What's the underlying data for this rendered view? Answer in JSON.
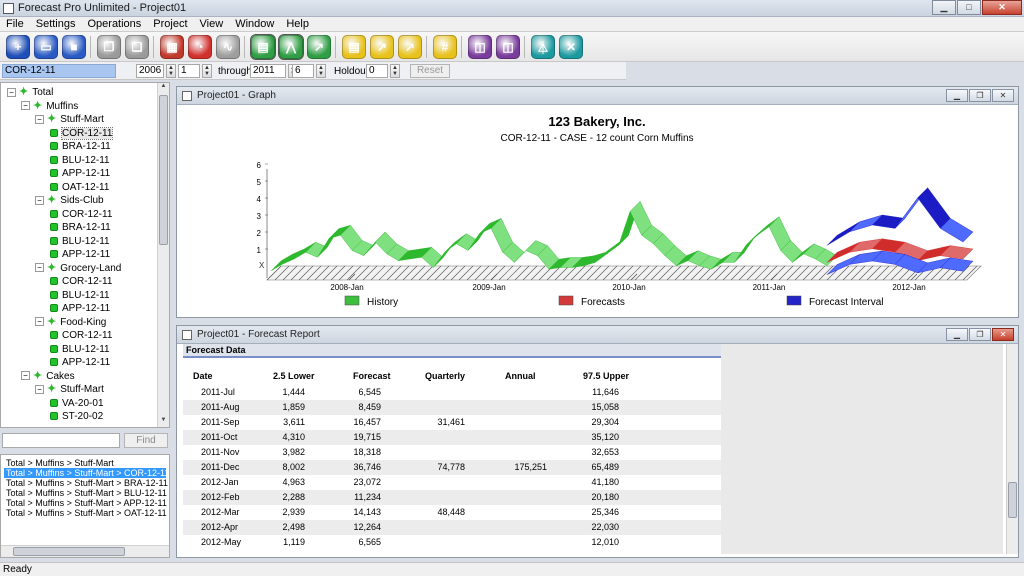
{
  "window": {
    "title": "Forecast Pro Unlimited - Project01"
  },
  "menu": [
    "File",
    "Settings",
    "Operations",
    "Project",
    "View",
    "Window",
    "Help"
  ],
  "toolbar": {
    "buttons": [
      {
        "name": "new-project-button",
        "icon": "new-icon",
        "color": "#1f4fb8"
      },
      {
        "name": "open-project-button",
        "icon": "folder-open-icon",
        "color": "#2a5bc4"
      },
      {
        "name": "save-project-button",
        "icon": "save-icon",
        "color": "#2a5bc4"
      },
      {
        "name": "copy-button",
        "icon": "copy-icon",
        "color": "#9a9a9a"
      },
      {
        "name": "paste-button",
        "icon": "paste-icon",
        "color": "#9a9a9a"
      },
      {
        "name": "movie-button",
        "icon": "clapper-icon",
        "color": "#c0392b"
      },
      {
        "name": "pie-chart-button",
        "icon": "pie-chart-icon",
        "color": "#d0312d"
      },
      {
        "name": "line-chart-button",
        "icon": "line-chart-icon",
        "color": "#9e9e9e"
      },
      {
        "name": "report-view-button",
        "icon": "report-icon",
        "color": "#2f9e44"
      },
      {
        "name": "graph-view-button",
        "icon": "graph-icon",
        "color": "#2f9e44"
      },
      {
        "name": "trend-button",
        "icon": "trend-icon",
        "color": "#2f9e44"
      },
      {
        "name": "notes-button",
        "icon": "notes-icon",
        "color": "#e8c21c"
      },
      {
        "name": "adjust-button",
        "icon": "adjust-icon",
        "color": "#e8c21c"
      },
      {
        "name": "override-button",
        "icon": "override-icon",
        "color": "#e8c21c"
      },
      {
        "name": "hash-button",
        "icon": "hash-icon",
        "color": "#e8c21c"
      },
      {
        "name": "windows-button",
        "icon": "windows-icon",
        "color": "#7a3c9c"
      },
      {
        "name": "settings-window-button",
        "icon": "settings-icon",
        "color": "#7a3c9c"
      },
      {
        "name": "filter-button",
        "icon": "filter-icon",
        "color": "#1c9aa0"
      },
      {
        "name": "tools-button",
        "icon": "tools-icon",
        "color": "#1c9aa0"
      }
    ]
  },
  "params": {
    "item": "COR-12-11",
    "start_year": "2006",
    "start_period": "1",
    "through_label": "through",
    "end_year": "2011",
    "end_period": "6",
    "holdout_label": "Holdout",
    "holdout": "0",
    "reset_label": "Reset"
  },
  "tree": [
    {
      "label": "Total",
      "level": 0,
      "type": "node"
    },
    {
      "label": "Muffins",
      "level": 1,
      "type": "node"
    },
    {
      "label": "Stuff-Mart",
      "level": 2,
      "type": "node"
    },
    {
      "label": "COR-12-11",
      "level": 3,
      "type": "leaf",
      "selected": true
    },
    {
      "label": "BRA-12-11",
      "level": 3,
      "type": "leaf"
    },
    {
      "label": "BLU-12-11",
      "level": 3,
      "type": "leaf"
    },
    {
      "label": "APP-12-11",
      "level": 3,
      "type": "leaf"
    },
    {
      "label": "OAT-12-11",
      "level": 3,
      "type": "leaf"
    },
    {
      "label": "Sids-Club",
      "level": 2,
      "type": "node"
    },
    {
      "label": "COR-12-11",
      "level": 3,
      "type": "leaf"
    },
    {
      "label": "BRA-12-11",
      "level": 3,
      "type": "leaf"
    },
    {
      "label": "BLU-12-11",
      "level": 3,
      "type": "leaf"
    },
    {
      "label": "APP-12-11",
      "level": 3,
      "type": "leaf"
    },
    {
      "label": "Grocery-Land",
      "level": 2,
      "type": "node"
    },
    {
      "label": "COR-12-11",
      "level": 3,
      "type": "leaf"
    },
    {
      "label": "BLU-12-11",
      "level": 3,
      "type": "leaf"
    },
    {
      "label": "APP-12-11",
      "level": 3,
      "type": "leaf"
    },
    {
      "label": "Food-King",
      "level": 2,
      "type": "node"
    },
    {
      "label": "COR-12-11",
      "level": 3,
      "type": "leaf"
    },
    {
      "label": "BLU-12-11",
      "level": 3,
      "type": "leaf"
    },
    {
      "label": "APP-12-11",
      "level": 3,
      "type": "leaf"
    },
    {
      "label": "Cakes",
      "level": 1,
      "type": "node"
    },
    {
      "label": "Stuff-Mart",
      "level": 2,
      "type": "node"
    },
    {
      "label": "VA-20-01",
      "level": 3,
      "type": "leaf"
    },
    {
      "label": "ST-20-02",
      "level": 3,
      "type": "leaf"
    }
  ],
  "find": {
    "value": "",
    "button_label": "Find"
  },
  "paths": [
    {
      "label": "Total > Muffins > Stuff-Mart",
      "selected": false
    },
    {
      "label": "Total > Muffins > Stuff-Mart > COR-12-11",
      "selected": true
    },
    {
      "label": "Total > Muffins > Stuff-Mart > BRA-12-11",
      "selected": false
    },
    {
      "label": "Total > Muffins > Stuff-Mart > BLU-12-11",
      "selected": false
    },
    {
      "label": "Total > Muffins > Stuff-Mart > APP-12-11",
      "selected": false
    },
    {
      "label": "Total > Muffins > Stuff-Mart > OAT-12-11",
      "selected": false
    }
  ],
  "graph_window": {
    "title": "Project01 - Graph",
    "chart_title": "123 Bakery, Inc.",
    "chart_subtitle": "COR-12-11 - CASE - 12 count Corn Muffins",
    "y_ticks": [
      "1",
      "2",
      "3",
      "4",
      "5",
      "6"
    ],
    "x_ticks": [
      "2008-Jan",
      "2009-Jan",
      "2010-Jan",
      "2011-Jan",
      "2012-Jan"
    ],
    "legend": [
      {
        "label": "History",
        "color": "#3cbf3c"
      },
      {
        "label": "Forecasts",
        "color": "#d53a3a"
      },
      {
        "label": "Forecast Interval",
        "color": "#2424c8"
      }
    ],
    "colors": {
      "history": "#2db82d",
      "history_light": "#7fe07f",
      "forecast": "#d02c2c",
      "interval": "#1c1cc4",
      "interval_light": "#4f6bff"
    }
  },
  "chart_data": {
    "type": "area",
    "title": "123 Bakery, Inc.",
    "subtitle": "COR-12-11 - CASE - 12 count Corn Muffins",
    "x_ticks": [
      "2008-Jan",
      "2009-Jan",
      "2010-Jan",
      "2011-Jan",
      "2012-Jan"
    ],
    "y_ticks": [
      1,
      2,
      3,
      4,
      5,
      6
    ],
    "series": [
      {
        "name": "History",
        "values": [
          0.3,
          0.7,
          1.0,
          1.4,
          1.1,
          2.2,
          2.4,
          1.5,
          1.2,
          2.0,
          1.3,
          0.9,
          1.0,
          1.1,
          0.5,
          1.4,
          1.9,
          1.5,
          2.5,
          2.8,
          1.4,
          0.8,
          1.5,
          1.2,
          0.4,
          0.5,
          0.5,
          0.6,
          0.8,
          1.3,
          1.8,
          3.8,
          2.4,
          1.9,
          1.2,
          0.6,
          0.9,
          0.6,
          0.4,
          0.8,
          0.8,
          1.8,
          2.4,
          2.9,
          1.5,
          0.8,
          1.3,
          1.0,
          0.6
        ]
      },
      {
        "name": "Forecasts",
        "values": [
          0.8,
          1.4,
          1.6,
          1.4,
          0.9,
          1.2,
          1.0
        ]
      },
      {
        "name": "Forecast Interval",
        "values": [
          1.8,
          2.6,
          3.0,
          2.8,
          4.6,
          2.8,
          2.0
        ]
      }
    ]
  },
  "report_window": {
    "title": "Project01 - Forecast Report",
    "section_title": "Forecast Data",
    "columns": [
      "Date",
      "2.5 Lower",
      "Forecast",
      "Quarterly",
      "Annual",
      "97.5 Upper"
    ],
    "rows": [
      [
        "2011-Jul",
        "1,444",
        "6,545",
        "",
        "",
        "11,646"
      ],
      [
        "2011-Aug",
        "1,859",
        "8,459",
        "",
        "",
        "15,058"
      ],
      [
        "2011-Sep",
        "3,611",
        "16,457",
        "31,461",
        "",
        "29,304"
      ],
      [
        "2011-Oct",
        "4,310",
        "19,715",
        "",
        "",
        "35,120"
      ],
      [
        "2011-Nov",
        "3,982",
        "18,318",
        "",
        "",
        "32,653"
      ],
      [
        "2011-Dec",
        "8,002",
        "36,746",
        "74,778",
        "175,251",
        "65,489"
      ],
      [
        "2012-Jan",
        "4,963",
        "23,072",
        "",
        "",
        "41,180"
      ],
      [
        "2012-Feb",
        "2,288",
        "11,234",
        "",
        "",
        "20,180"
      ],
      [
        "2012-Mar",
        "2,939",
        "14,143",
        "48,448",
        "",
        "25,346"
      ],
      [
        "2012-Apr",
        "2,498",
        "12,264",
        "",
        "",
        "22,030"
      ],
      [
        "2012-May",
        "1,119",
        "6,565",
        "",
        "",
        "12,010"
      ]
    ]
  },
  "status": "Ready"
}
